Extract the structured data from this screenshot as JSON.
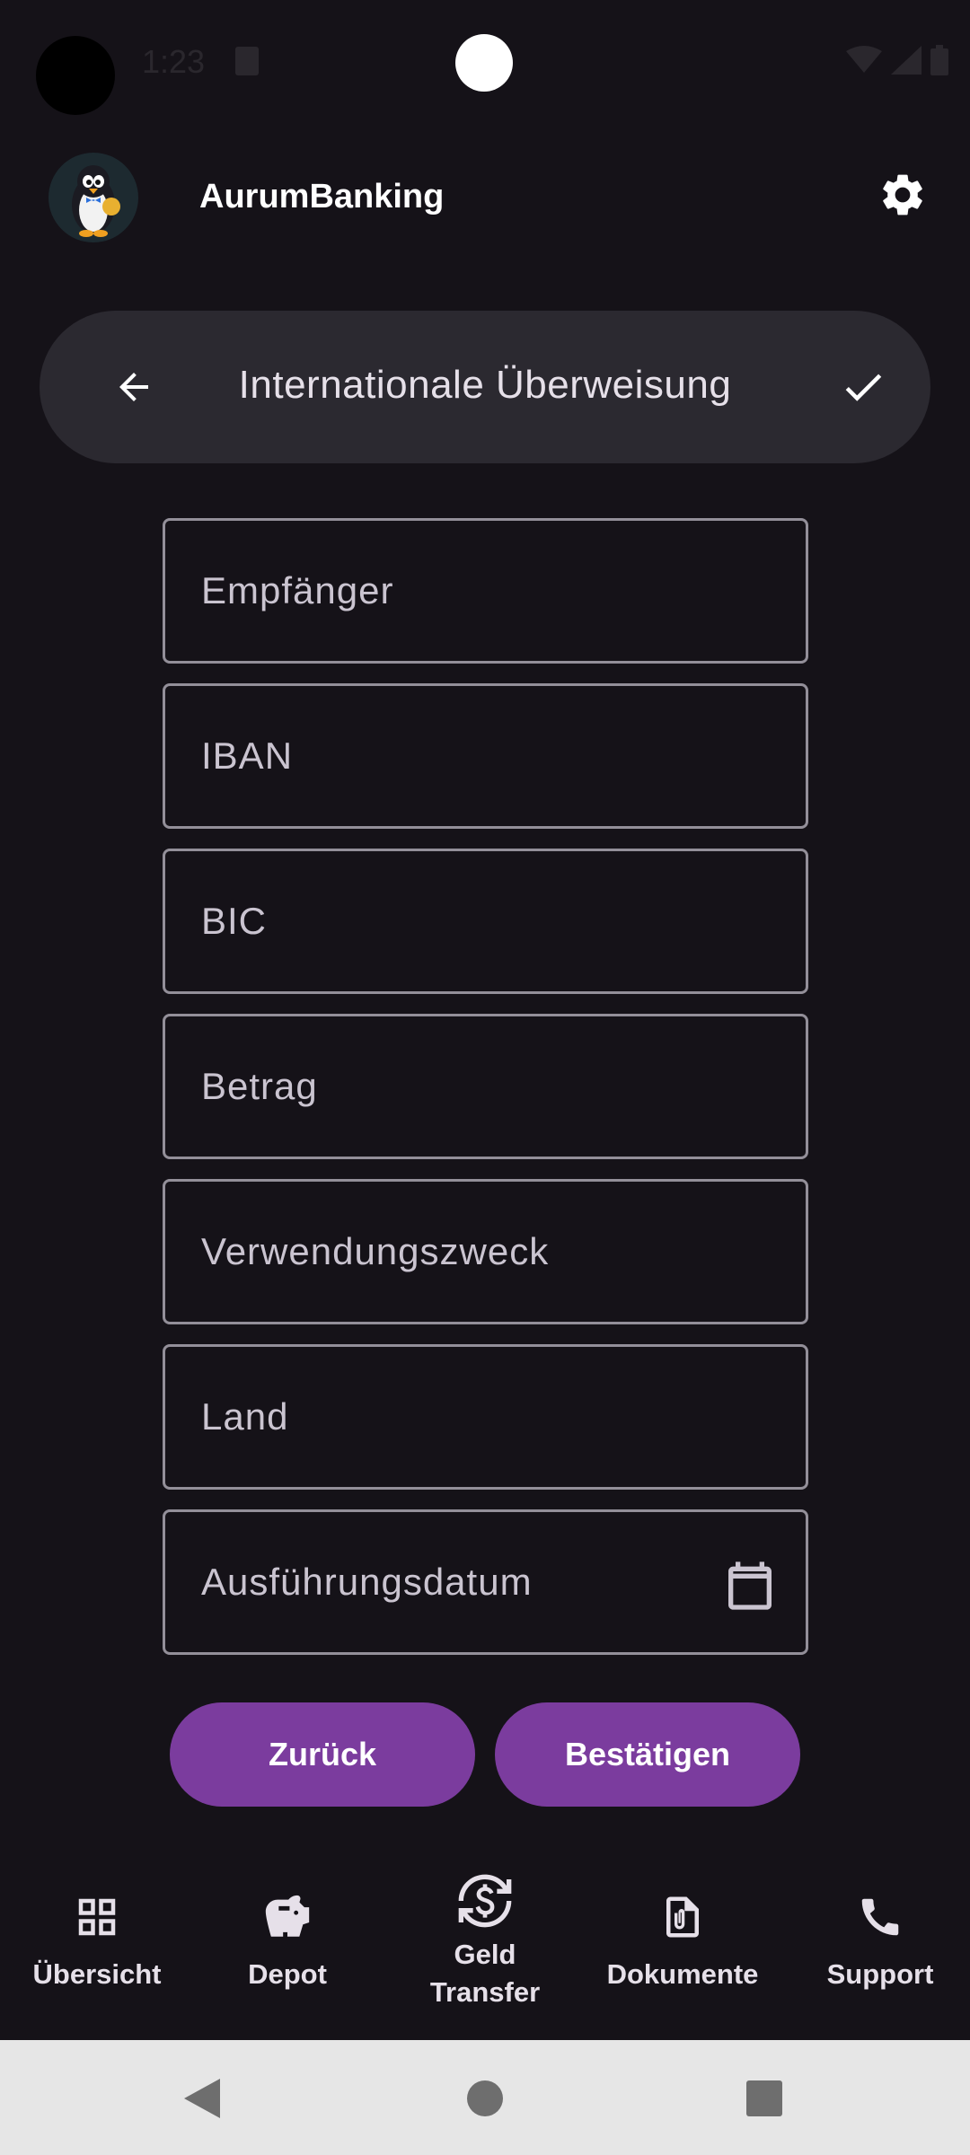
{
  "status_bar": {
    "time": "1:23"
  },
  "app_bar": {
    "title": "AurumBanking",
    "avatar_icon": "penguin-avatar",
    "settings_icon": "gear-icon"
  },
  "header": {
    "title": "Internationale Überweisung",
    "back_icon": "arrow-left-icon",
    "confirm_icon": "check-icon"
  },
  "form": {
    "recipient_placeholder": "Empfänger",
    "iban_placeholder": "IBAN",
    "bic_placeholder": "BIC",
    "amount_placeholder": "Betrag",
    "purpose_placeholder": "Verwendungszweck",
    "country_placeholder": "Land",
    "date_placeholder": "Ausführungsdatum"
  },
  "actions": {
    "back_label": "Zurück",
    "confirm_label": "Bestätigen"
  },
  "bottom_nav": {
    "items": [
      {
        "label": "Übersicht",
        "icon": "grid-icon"
      },
      {
        "label": "Depot",
        "icon": "piggy-bank-icon"
      },
      {
        "label": "Geld\nTransfer",
        "icon": "money-transfer-icon"
      },
      {
        "label": "Dokumente",
        "icon": "paperclip-document-icon"
      },
      {
        "label": "Support",
        "icon": "phone-icon"
      }
    ]
  },
  "colors": {
    "background": "#151218",
    "surface": "#2b2930",
    "accent": "#7b3c9e",
    "outline": "#938f99"
  }
}
